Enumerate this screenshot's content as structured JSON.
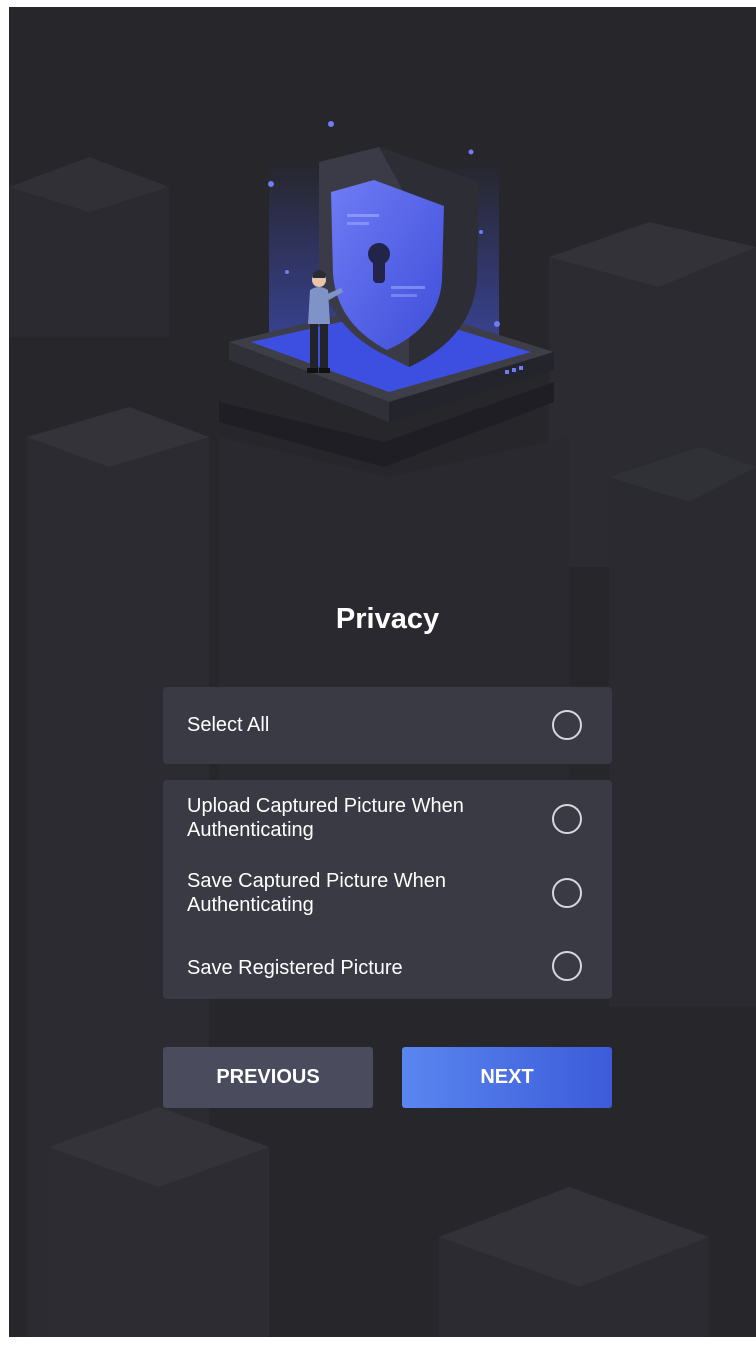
{
  "page": {
    "title": "Privacy"
  },
  "select_all": {
    "label": "Select All",
    "checked": false
  },
  "options": [
    {
      "label_line1": "Upload Captured Picture When",
      "label_line2": "Authenticating",
      "checked": false
    },
    {
      "label_line1": "Save Captured Picture When",
      "label_line2": "Authenticating",
      "checked": false
    },
    {
      "label_line1": "Save Registered Picture",
      "label_line2": "",
      "checked": false
    }
  ],
  "buttons": {
    "previous_label": "PREVIOUS",
    "next_label": "NEXT"
  },
  "colors": {
    "background": "#26262b",
    "card": "#3a3a45",
    "previous_button": "#4a4b5c",
    "next_button_start": "#5a86f0",
    "next_button_end": "#3c5bd9",
    "accent_blue": "#4a5cf0"
  },
  "illustration": {
    "icon": "shield-lock-icon",
    "description_icon": "person-with-shield-icon"
  }
}
